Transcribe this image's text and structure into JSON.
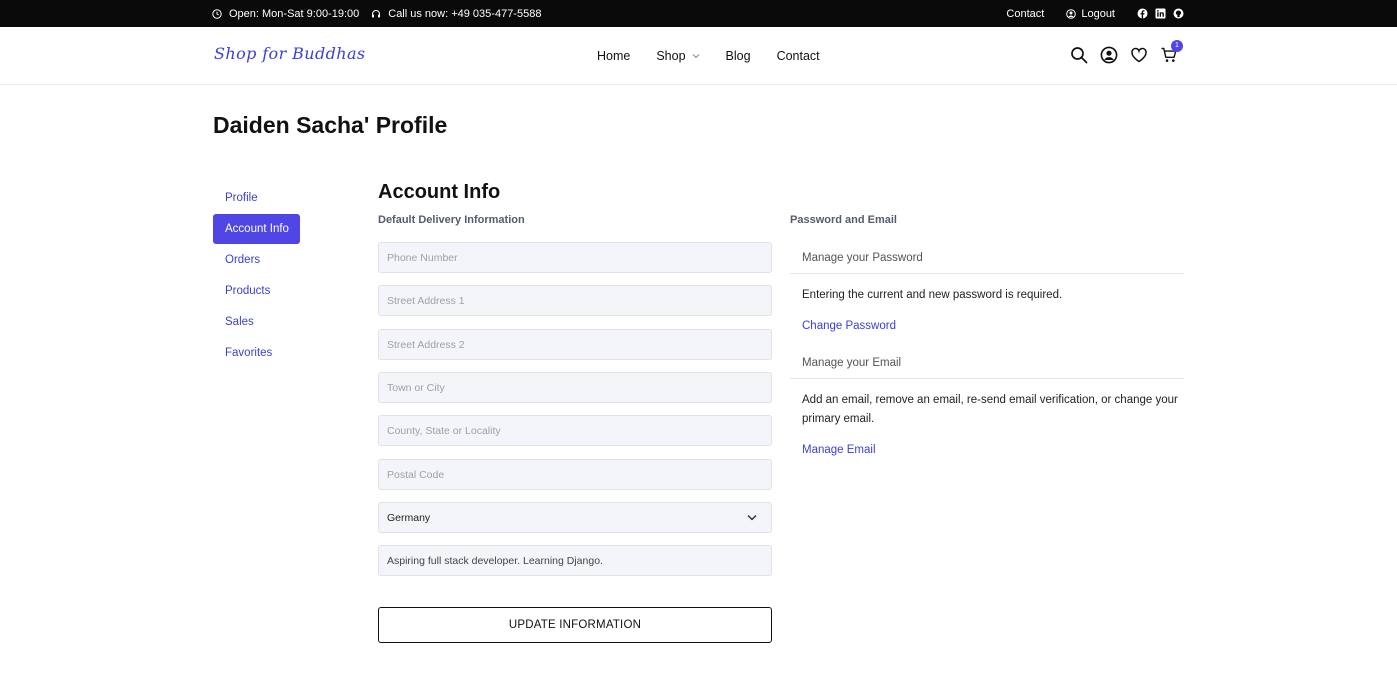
{
  "topbar": {
    "hours": "Open: Mon-Sat 9:00-19:00",
    "phone": "Call us now: +49 035-477-5588",
    "contact": "Contact",
    "logout": "Logout"
  },
  "navbar": {
    "logo": "Shop for Buddhas",
    "links": [
      "Home",
      "Shop",
      "Blog",
      "Contact"
    ],
    "cart_count": "1"
  },
  "page": {
    "title": "Daiden Sacha' Profile"
  },
  "sidebar": {
    "items": [
      "Profile",
      "Account Info",
      "Orders",
      "Products",
      "Sales",
      "Favorites"
    ],
    "active": "Account Info"
  },
  "account": {
    "title": "Account Info",
    "delivery_heading": "Default Delivery Information",
    "fields": {
      "phone": "Phone Number",
      "street1": "Street Address 1",
      "street2": "Street Address 2",
      "city": "Town or City",
      "county": "County, State or Locality",
      "postal": "Postal Code",
      "country": "Germany",
      "bio": "Aspiring full stack developer. Learning Django."
    },
    "update_button": "UPDATE INFORMATION"
  },
  "security": {
    "heading": "Password and Email",
    "password_title": "Manage your Password",
    "password_text": "Entering the current and new password is required.",
    "password_link": "Change Password",
    "email_title": "Manage your Email",
    "email_text": "Add an email, remove an email, re-send email verification, or change your primary email.",
    "email_link": "Manage Email"
  },
  "colors": {
    "accent": "#4f46e5",
    "link": "#3a3fd8",
    "topbar_bg": "#0a0a0a"
  },
  "icons": [
    "clock-icon",
    "headset-icon",
    "user-circle-icon",
    "facebook-icon",
    "linkedin-icon",
    "github-icon",
    "search-icon",
    "account-icon",
    "heart-icon",
    "cart-icon",
    "chevron-down-icon"
  ]
}
